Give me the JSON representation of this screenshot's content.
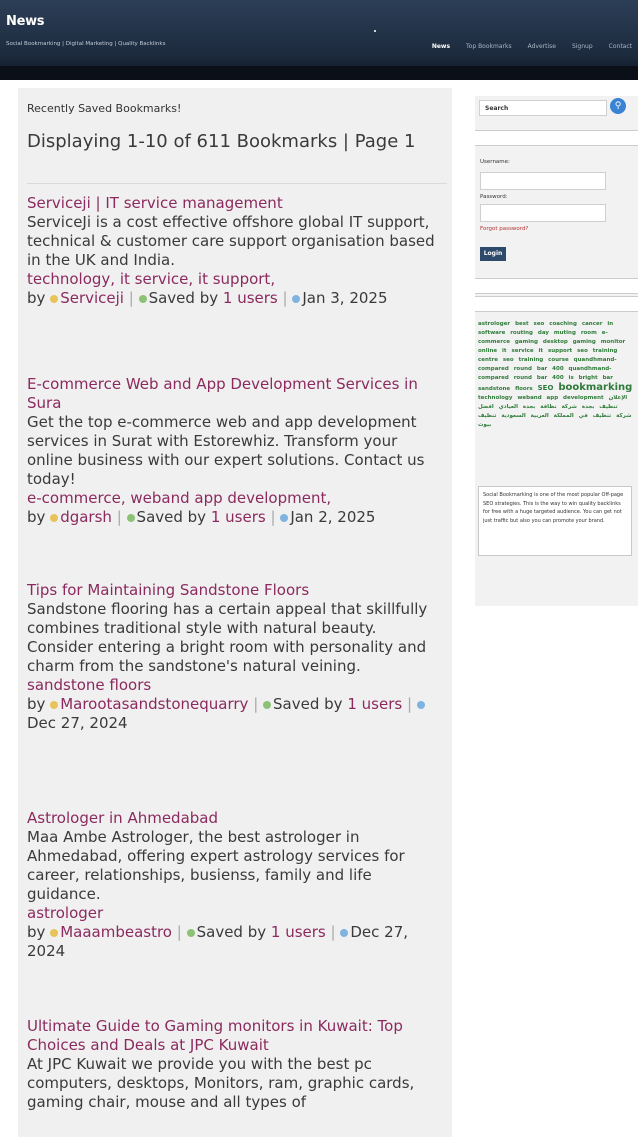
{
  "site": {
    "logo": "News",
    "tagline": "Social Bookmarking | Digital Marketing | Quality Backlinks"
  },
  "nav": [
    {
      "label": "News",
      "active": true
    },
    {
      "label": "Top Bookmarks",
      "active": false
    },
    {
      "label": "Advertise",
      "active": false
    },
    {
      "label": "Signup",
      "active": false
    },
    {
      "label": "Contact",
      "active": false
    }
  ],
  "main": {
    "recent_heading": "Recently Saved Bookmarks!",
    "displaying": "Displaying 1-10 of 611 Bookmarks | Page 1"
  },
  "bookmarks": [
    {
      "title": "Serviceji | IT service management",
      "description": "ServiceJi is a cost effective offshore global IT support, technical & customer care support organisation based in the UK and India.",
      "tags": "technology, it service, it support,",
      "by": "by",
      "user": "Serviceji",
      "saved_prefix": "Saved by",
      "saved_count": "1 users",
      "date": "Jan 3, 2025"
    },
    {
      "title": "E-commerce Web and App Development Services in Sura",
      "description": "Get the top e-commerce web and app development services in Surat with Estorewhiz. Transform your online business with our expert solutions. Contact us today!",
      "tags": "e-commerce, weband app development,",
      "by": "by",
      "user": "dgarsh",
      "saved_prefix": "Saved by",
      "saved_count": "1 users",
      "date": "Jan 2, 2025"
    },
    {
      "title": "Tips for Maintaining Sandstone Floors",
      "description": "Sandstone flooring has a certain appeal that skillfully combines traditional style with natural beauty. Consider entering a bright room with personality and charm from the sandstone's natural veining.",
      "tags": "sandstone floors",
      "by": "by",
      "user": "Marootasandstonequarry",
      "saved_prefix": "Saved by",
      "saved_count": "1 users",
      "date": "Dec 27, 2024"
    },
    {
      "title": "Astrologer in Ahmedabad",
      "description": "Maa Ambe Astrologer, the best astrologer in Ahmedabad, offering expert astrology services for career, relationships, busienss, family and life guidance.",
      "tags": "astrologer",
      "by": "by",
      "user": "Maaambeastro",
      "saved_prefix": "Saved by",
      "saved_count": "1 users",
      "date": "Dec 27, 2024"
    },
    {
      "title": "Ultimate Guide to Gaming monitors in Kuwait: Top Choices and Deals at JPC Kuwait",
      "description": "At JPC Kuwait we provide you with the best pc computers, desktops, Monitors, ram, graphic cards, gaming chair, mouse and all types of"
    }
  ],
  "sidebar": {
    "search_value": "Search",
    "username_label": "Username:",
    "password_label": "Password:",
    "forgot": "Forgot password?",
    "login": "Login",
    "tag_cloud": {
      "small1": "astrologer best seo coaching cancer in software routing day muting room e-commerce gaming desktop gaming monitor online it service it support seo training centre seo training course quandhmand-compared round bar 400 quandhmand-compared round bar 400 is bright bar sandstone floors",
      "mid1": "SEO",
      "big": "bookmarking",
      "small2": "technology weband app development",
      "arabic": "الإعلان تنظيف بجدة شركة نظافة بجدة العيادي افضل شركة تنظيف في المملكة العربية السعودية تنظيف بيوت"
    },
    "about": "Social Bookmarking is one of the most popular Off-page SEO strategies. This is the way to win quality backlinks for free with a huge targeted audience. You can get not just traffic but also you can promote your brand."
  },
  "colors": {
    "header": "#1c2a3d",
    "link": "#8b2a5e",
    "tag_cloud": "#2f7b3a",
    "search_button": "#3a82d4"
  }
}
